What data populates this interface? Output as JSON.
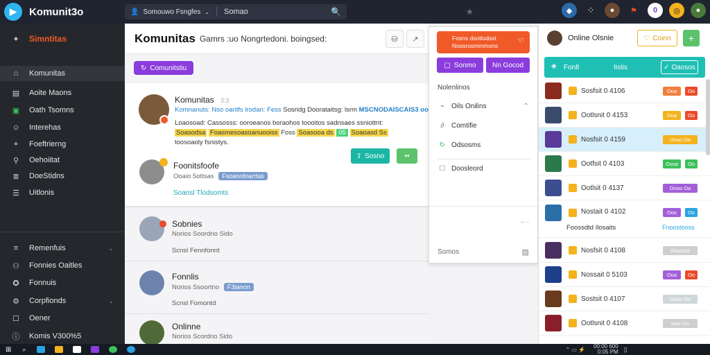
{
  "topbar": {
    "app_name": "Komunit3o",
    "search_scope": "Somouwo Fsngfes",
    "search_value": "Somao",
    "notification_count": "0"
  },
  "sidebar": {
    "brand": "Simntitas",
    "items": [
      {
        "label": "Komunitas",
        "icon": "home-icon"
      },
      {
        "label": "Aoite Maons",
        "icon": "page-icon"
      },
      {
        "label": "Oath Tsomns",
        "icon": "calendar-icon"
      },
      {
        "label": "Interehas",
        "icon": "person-icon"
      },
      {
        "label": "Foeftrierng",
        "icon": "tag-icon"
      },
      {
        "label": "Oehoiitat",
        "icon": "pin-icon"
      },
      {
        "label": "DoeStidns",
        "icon": "notes-icon"
      },
      {
        "label": "Uitlonis",
        "icon": "list-icon"
      },
      {
        "label": "Remenfuis",
        "icon": "bell-icon"
      },
      {
        "label": "Fonnies Oaitles",
        "icon": "users-icon"
      },
      {
        "label": "Fonnuis",
        "icon": "forum-icon"
      },
      {
        "label": "Corpfionds",
        "icon": "settings-icon"
      },
      {
        "label": "Oener",
        "icon": "chat-icon"
      },
      {
        "label": "Komis V300%5",
        "icon": "info-icon"
      }
    ]
  },
  "main": {
    "title": "Komunitas",
    "subtitle": "Gamrs :uo Nongrtedoni. boingsed:",
    "community_button": "Comunitstiu",
    "post": {
      "author": "Komunitas",
      "author_meta": "3:3",
      "line1_a": "Komnanuts: Nso oaritfs lrodan: Fess",
      "line1_b": "Sosridg Doorataitsg: lsrm",
      "line1_c": "MSCNODAISCAIS3 oolit.",
      "line2": "Loaosoad: Cassosss: ooroeanos boraohos toooitos sadnsaes ssniottnt:",
      "hl1": "Soasodsa",
      "hl2": "Foasmesoasoanuooiss",
      "plain": "Foss",
      "hl3": "Soasooa ds",
      "hl4": "05",
      "hl5": "Soaoasd Ss",
      "line4": "toosoaoly fsnistys."
    },
    "subpost": {
      "name": "Foonitsfoofe",
      "meta": "Ooaio 5ottsas",
      "tag": "Fsoannfoarrtas",
      "link": "Soansl Tlodsomts",
      "teal_button": "Sosno",
      "green_button": "••"
    },
    "feed": [
      {
        "name": "Sobnies",
        "meta": "Norios Soordno Sido",
        "sub": "Scnsl Fennfonnt",
        "tag": ""
      },
      {
        "name": "Fonnlis",
        "meta": "Norios Ssoortno",
        "sub": "Scnsl Fomontd",
        "tag": "F3tanon"
      },
      {
        "name": "Onlinne",
        "meta": "Norios Scordno Sido",
        "sub": "",
        "tag": ""
      }
    ]
  },
  "popup": {
    "banner_line1": "Fosns dsotlodsst",
    "banner_line2": "Nossrosmmmons",
    "btn_primary": "Sonmo",
    "btn_secondary": "Nn Gocod",
    "section_label": "Nolenlinos",
    "items": [
      "Oils Onilins",
      "Comtifie",
      "Odsosms",
      "Doosleord"
    ],
    "footer_label": "Somos",
    "footer_right": "·· ·"
  },
  "rpanel": {
    "user_name": "Online Olsnie",
    "follow_button": "Coinn",
    "add_button": "+",
    "tab_a": "Fonlt",
    "tab_b": "Iistis",
    "tab_c": "Oaosos",
    "rows": [
      {
        "title": "Sosfsit 0 4106",
        "pill_a": "Ooa",
        "pill_b": "Oo",
        "color_a": "#f0803c",
        "color_b": "#e94b2b",
        "thumb": "#8a2d1e"
      },
      {
        "title": "Ootlsnit 0 4153",
        "pill_a": "Ooa",
        "pill_b": "Oo",
        "color_a": "#f4b21c",
        "color_b": "#e94b2b",
        "thumb": "#3a4c6b"
      },
      {
        "title": "Nosfsit 0 4159",
        "pill_a": "Osoo Oa",
        "pill_b": "",
        "color_a": "#f4b21c",
        "color_b": "",
        "thumb": "#5a3a9a"
      },
      {
        "title": "Ootfsit 0 4103",
        "pill_a": "Osoa",
        "pill_b": "Oo",
        "color_a": "#3cc05a",
        "color_b": "#3cc05a",
        "thumb": "#2a7a4a"
      },
      {
        "title": "Ootlsit 0 4137",
        "pill_a": "Onoo Oa",
        "pill_b": "",
        "color_a": "#a35fd8",
        "color_b": "",
        "thumb": "#3b4e8f"
      },
      {
        "title": "Nostait 0 4102",
        "pill_a": "Ooo",
        "pill_b": "Oo",
        "color_a": "#a35fd8",
        "color_b": "#2aa3e0",
        "thumb": "#2b6fa8"
      },
      {
        "title": "Nosfsit 0 4108",
        "pill_a": "Ilsoosos",
        "pill_b": "",
        "color_a": "#cfcfcf",
        "color_b": "",
        "thumb": "#4a3060"
      },
      {
        "title": "Nossait 0 5103",
        "pill_a": "Ooa",
        "pill_b": "Oo",
        "color_a": "#a35fd8",
        "color_b": "#e94b2b",
        "thumb": "#1e3f8a"
      },
      {
        "title": "Sostsit 0 4107",
        "pill_a": "Ooos Oo",
        "pill_b": "",
        "color_a": "#cfd8d8",
        "color_b": "",
        "thumb": "#6a3a1e"
      },
      {
        "title": "Ootlsnit 0 4108",
        "pill_a": "Isoo Oo",
        "pill_b": "",
        "color_a": "#cfcfcf",
        "color_b": "",
        "thumb": "#8a1e2a"
      }
    ],
    "row_sub": "Foossdtd Ilosaits",
    "row_sub_link": "Fnoostooss"
  },
  "taskbar": {
    "time": "00:00 600",
    "date": "0:05 PM"
  }
}
